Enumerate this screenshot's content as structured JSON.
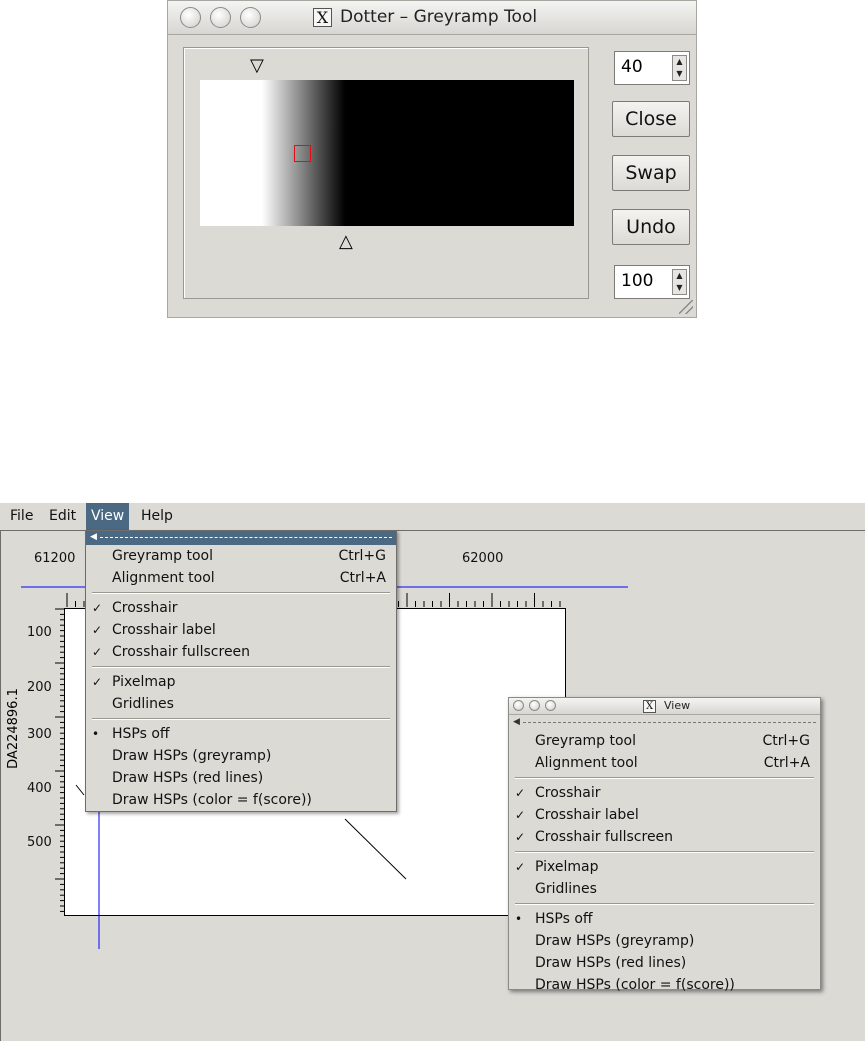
{
  "greyramp_window": {
    "title": "Dotter – Greyramp Tool",
    "top_value": "40",
    "bottom_value": "100",
    "buttons": {
      "close": "Close",
      "swap": "Swap",
      "undo": "Undo"
    }
  },
  "main_window": {
    "menubar": [
      {
        "label": "File",
        "active": false
      },
      {
        "label": "Edit",
        "active": false
      },
      {
        "label": "View",
        "active": true
      },
      {
        "label": "Help",
        "active": false
      }
    ],
    "plot": {
      "x_ticks": [
        "61200",
        "62000"
      ],
      "y_ticks": [
        "100",
        "200",
        "300",
        "400",
        "500"
      ],
      "y_title": "DA224896.1",
      "crosshair_color": "#0000ff"
    }
  },
  "view_menu": {
    "items": [
      {
        "type": "item",
        "label": "Greyramp tool",
        "accel": "Ctrl+G",
        "check": ""
      },
      {
        "type": "item",
        "label": "Alignment tool",
        "accel": "Ctrl+A",
        "check": ""
      },
      {
        "type": "sep"
      },
      {
        "type": "item",
        "label": "Crosshair",
        "accel": "",
        "check": "✓"
      },
      {
        "type": "item",
        "label": "Crosshair label",
        "accel": "",
        "check": "✓"
      },
      {
        "type": "item",
        "label": "Crosshair fullscreen",
        "accel": "",
        "check": "✓"
      },
      {
        "type": "sep"
      },
      {
        "type": "item",
        "label": "Pixelmap",
        "accel": "",
        "check": "✓"
      },
      {
        "type": "item",
        "label": "Gridlines",
        "accel": "",
        "check": ""
      },
      {
        "type": "sep"
      },
      {
        "type": "item",
        "label": "HSPs off",
        "accel": "",
        "check": "•"
      },
      {
        "type": "item",
        "label": "Draw HSPs (greyramp)",
        "accel": "",
        "check": ""
      },
      {
        "type": "item",
        "label": "Draw HSPs (red lines)",
        "accel": "",
        "check": ""
      },
      {
        "type": "item",
        "label": "Draw HSPs (color = f(score))",
        "accel": "",
        "check": ""
      }
    ]
  },
  "view_window": {
    "title": "View"
  }
}
